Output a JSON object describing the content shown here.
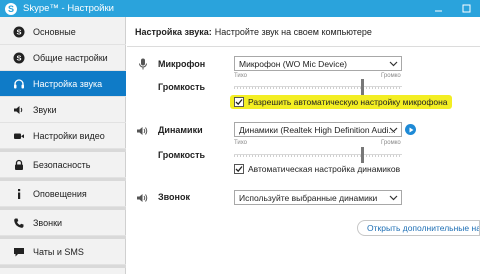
{
  "window": {
    "title": "Skype™ - Настройки",
    "logo_letter": "S"
  },
  "sidebar": {
    "items": [
      {
        "label": "Основные",
        "icon": "skype-icon"
      },
      {
        "label": "Общие настройки",
        "icon": "skype-icon"
      },
      {
        "label": "Настройка звука",
        "icon": "headset-icon"
      },
      {
        "label": "Звуки",
        "icon": "speaker-icon"
      },
      {
        "label": "Настройки видео",
        "icon": "camera-icon"
      },
      {
        "label": "Безопасность",
        "icon": "lock-icon"
      },
      {
        "label": "Оповещения",
        "icon": "info-icon"
      },
      {
        "label": "Звонки",
        "icon": "phone-icon"
      },
      {
        "label": "Чаты и SMS",
        "icon": "chat-icon"
      }
    ]
  },
  "header": {
    "title": "Настройка звука:",
    "subtitle": "Настройте звук на своем компьютере"
  },
  "microphone": {
    "label": "Микрофон",
    "device": "Микрофон (WO Mic Device)",
    "volume_label": "Громкость",
    "scale_min": "Тихо",
    "scale_max": "Громко",
    "level": 0.76,
    "auto_label": "Разрешить автоматическую настройку микрофона",
    "auto_checked": true
  },
  "speakers": {
    "label": "Динамики",
    "device": "Динамики (Realtek High Definition Audi...",
    "volume_label": "Громкость",
    "scale_min": "Тихо",
    "scale_max": "Громко",
    "level": 0.76,
    "auto_label": "Автоматическая настройка динамиков",
    "auto_checked": true
  },
  "ringer": {
    "label": "Звонок",
    "device": "Используйте выбранные динамики"
  },
  "advanced_button": "Открыть дополнительные настро",
  "colors": {
    "titlebar": "#2aa3dc",
    "active": "#0f7bc7",
    "highlight": "#f3ee23",
    "link": "#1e6fb5"
  }
}
